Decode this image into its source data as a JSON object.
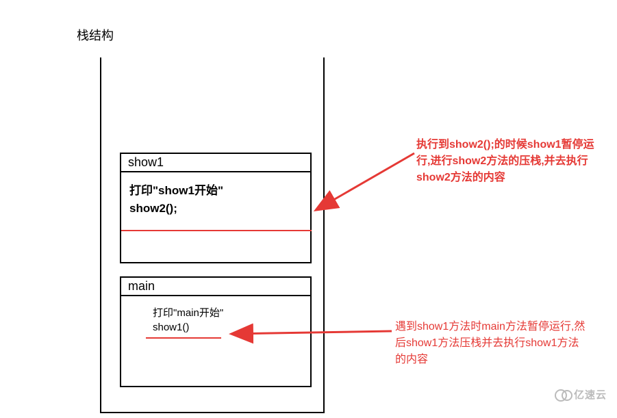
{
  "title": "栈结构",
  "frames": {
    "show1": {
      "name": "show1",
      "line1": "打印\"show1开始\"",
      "line2": "show2();"
    },
    "main": {
      "name": "main",
      "line1": "打印\"main开始\"",
      "line2": "show1()"
    }
  },
  "annotations": {
    "top": "执行到show2();的时候show1暂停运行,进行show2方法的压栈,并去执行show2方法的内容",
    "bottom": "遇到show1方法时main方法暂停运行,然后show1方法压栈并去执行show1方法的内容"
  },
  "watermark": "亿速云",
  "colors": {
    "accent": "#e53935",
    "border": "#000000"
  },
  "chart_data": {
    "type": "diagram",
    "description": "Call stack illustration",
    "stack_frames": [
      {
        "order_from_bottom": 1,
        "method": "main",
        "statements": [
          "打印\"main开始\"",
          "show1()"
        ],
        "paused_at": "show1()",
        "note": "遇到show1方法时main方法暂停运行,然后show1方法压栈并去执行show1方法的内容"
      },
      {
        "order_from_bottom": 2,
        "method": "show1",
        "statements": [
          "打印\"show1开始\"",
          "show2();"
        ],
        "paused_at": "show2();",
        "note": "执行到show2();的时候show1暂停运行,进行show2方法的压栈,并去执行show2方法的内容"
      }
    ]
  }
}
